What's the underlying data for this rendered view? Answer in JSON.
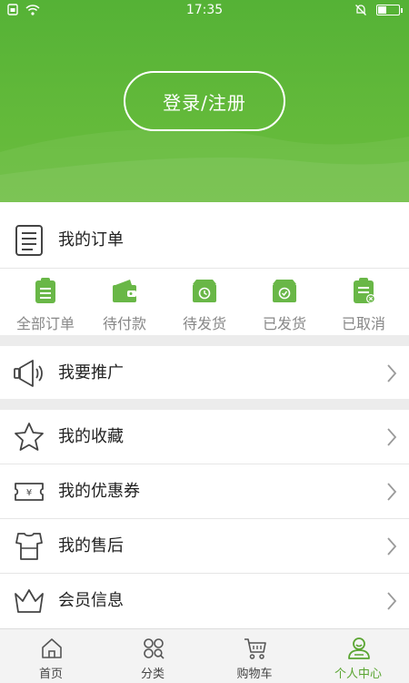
{
  "status_bar": {
    "time": "17:35"
  },
  "header": {
    "login_label": "登录/注册"
  },
  "orders": {
    "title": "我的订单",
    "tabs": [
      {
        "label": "全部订单",
        "icon": "clipboard-icon"
      },
      {
        "label": "待付款",
        "icon": "wallet-icon"
      },
      {
        "label": "待发货",
        "icon": "box-clock-icon"
      },
      {
        "label": "已发货",
        "icon": "box-check-icon"
      },
      {
        "label": "已取消",
        "icon": "clipboard-cancel-icon"
      }
    ]
  },
  "menu": {
    "promote": "我要推广",
    "favorites": "我的收藏",
    "coupons": "我的优惠券",
    "aftersale": "我的售后",
    "member": "会员信息"
  },
  "tabbar": {
    "items": [
      {
        "label": "首页",
        "icon": "home-icon"
      },
      {
        "label": "分类",
        "icon": "category-icon"
      },
      {
        "label": "购物车",
        "icon": "cart-icon"
      },
      {
        "label": "个人中心",
        "icon": "user-icon",
        "active": true
      }
    ]
  },
  "colors": {
    "accent": "#5aa532",
    "header": "#62b93a"
  }
}
